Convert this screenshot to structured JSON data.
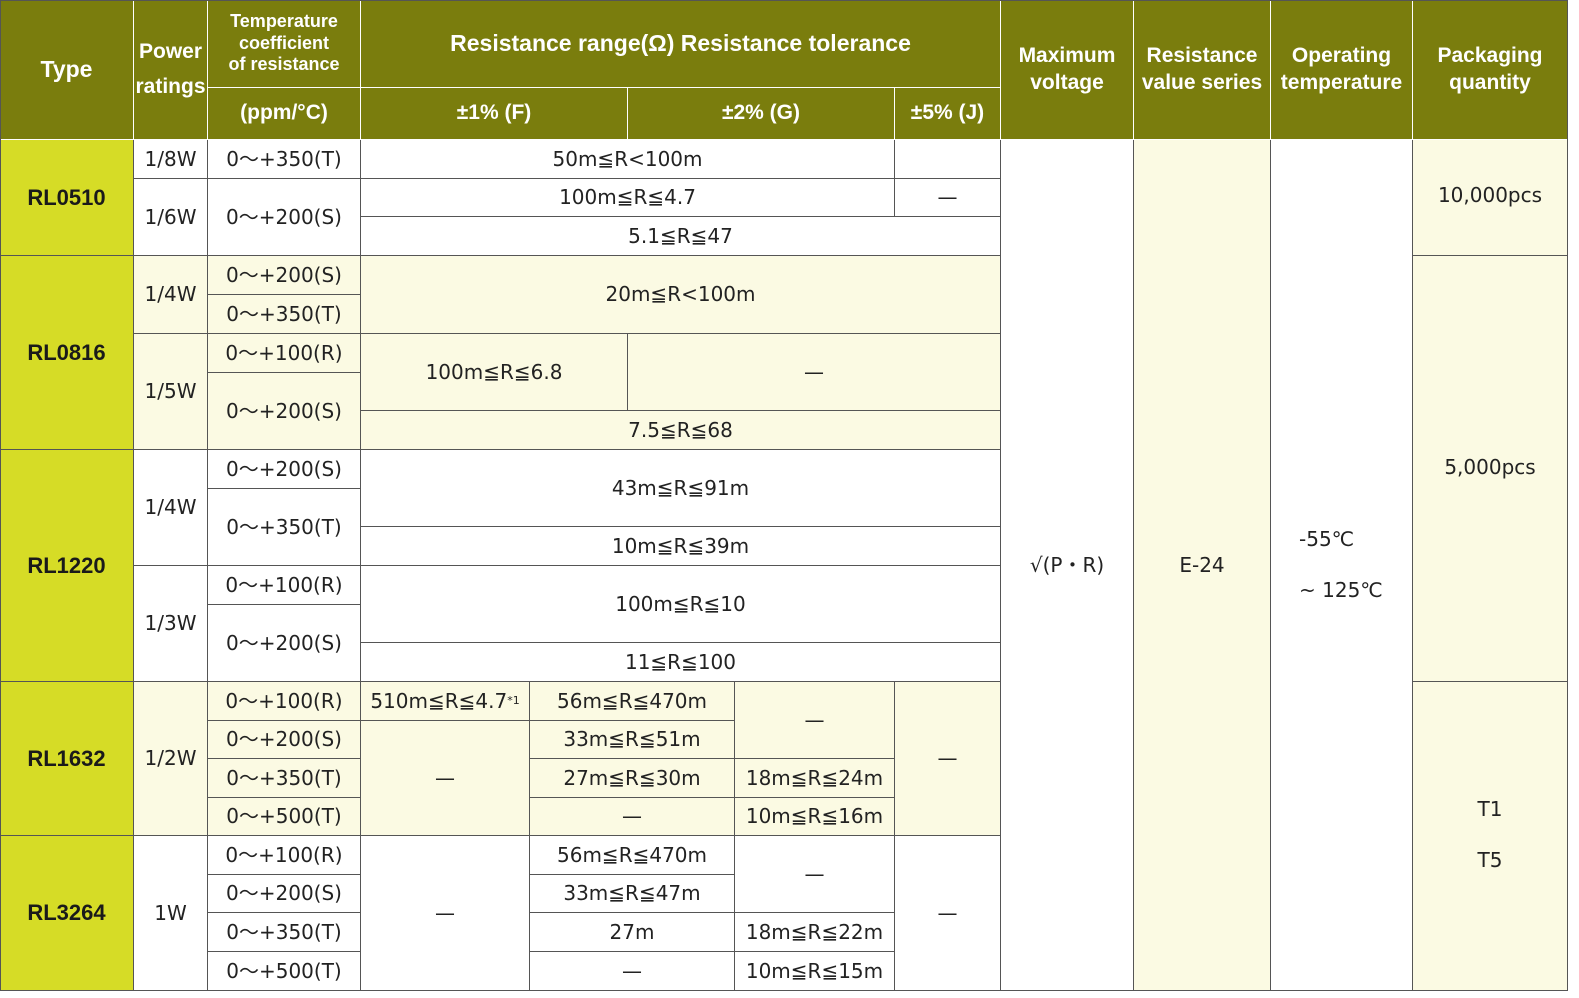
{
  "header": {
    "type": "Type",
    "power_1": "Power",
    "power_2": "ratings",
    "tcr_1": "Temperature",
    "tcr_2": "coefficient",
    "tcr_3": "of resistance",
    "tcr_unit": "(ppm/°C)",
    "range": "Resistance range(Ω) Resistance tolerance",
    "tol_f": "±1% (F)",
    "tol_g": "±2% (G)",
    "tol_j": "±5% (J)",
    "maxv_1": "Maximum",
    "maxv_2": "voltage",
    "series_1": "Resistance",
    "series_2": "value series",
    "optemp_1": "Operating",
    "optemp_2": "temperature",
    "pack_1": "Packaging",
    "pack_2": "quantity"
  },
  "types": {
    "rl0510": "RL0510",
    "rl0816": "RL0816",
    "rl1220": "RL1220",
    "rl1632": "RL1632",
    "rl3264": "RL3264"
  },
  "power": {
    "p18": "1/8W",
    "p16": "1/6W",
    "p14a": "1/4W",
    "p15": "1/5W",
    "p14b": "1/4W",
    "p13": "1/3W",
    "p12": "1/2W",
    "p1": "1W"
  },
  "tcr": {
    "r0510_1": "0～+350(T)",
    "r0510_2": "0～+200(S)",
    "r0816_1": "0～+200(S)",
    "r0816_2": "0～+350(T)",
    "r0816_3": "0～+100(R)",
    "r0816_4": "0～+200(S)",
    "r1220_1": "0～+200(S)",
    "r1220_2": "0～+350(T)",
    "r1220_3": "0～+100(R)",
    "r1220_4": "0～+200(S)",
    "r1632_1": "0～+100(R)",
    "r1632_2": "0～+200(S)",
    "r1632_3": "0～+350(T)",
    "r1632_4": "0～+500(T)",
    "r3264_1": "0～+100(R)",
    "r3264_2": "0～+200(S)",
    "r3264_3": "0～+350(T)",
    "r3264_4": "0～+500(T)"
  },
  "ranges": {
    "r0510_a": "50m≦R<100m",
    "r0510_b": "100m≦R≦4.7",
    "r0510_c": "5.1≦R≦47",
    "r0816_a": "20m≦R<100m",
    "r0816_b": "100m≦R≦6.8",
    "r0816_c": "7.5≦R≦68",
    "r1220_a": "43m≦R≦91m",
    "r1220_b": "10m≦R≦39m",
    "r1220_c": "100m≦R≦10",
    "r1220_d": "11≦R≦100",
    "r1632_f1": "510m≦R≦4.7",
    "r1632_f1_note": "*1",
    "r1632_g1": "56m≦R≦470m",
    "r1632_g2": "33m≦R≦51m",
    "r1632_g3": "27m≦R≦30m",
    "r1632_h3": "18m≦R≦24m",
    "r1632_h4": "10m≦R≦16m",
    "r3264_g1": "56m≦R≦470m",
    "r3264_g2": "33m≦R≦47m",
    "r3264_g3": "27m",
    "r3264_h3": "18m≦R≦22m",
    "r3264_h4": "10m≦R≦15m"
  },
  "dash": "—",
  "common": {
    "max_voltage": "√(P・R)",
    "series": "E-24",
    "temp_1": "-55℃",
    "temp_2": "~ 125℃"
  },
  "packaging": {
    "p0510": "10,000pcs",
    "p5000": "5,000pcs",
    "t1": "T1",
    "t5": "T5"
  },
  "colors": {
    "header_bg": "#7a7d0d",
    "type_bg": "#d6dc26",
    "row_tint": "#fbfae3",
    "border": "#555555"
  }
}
